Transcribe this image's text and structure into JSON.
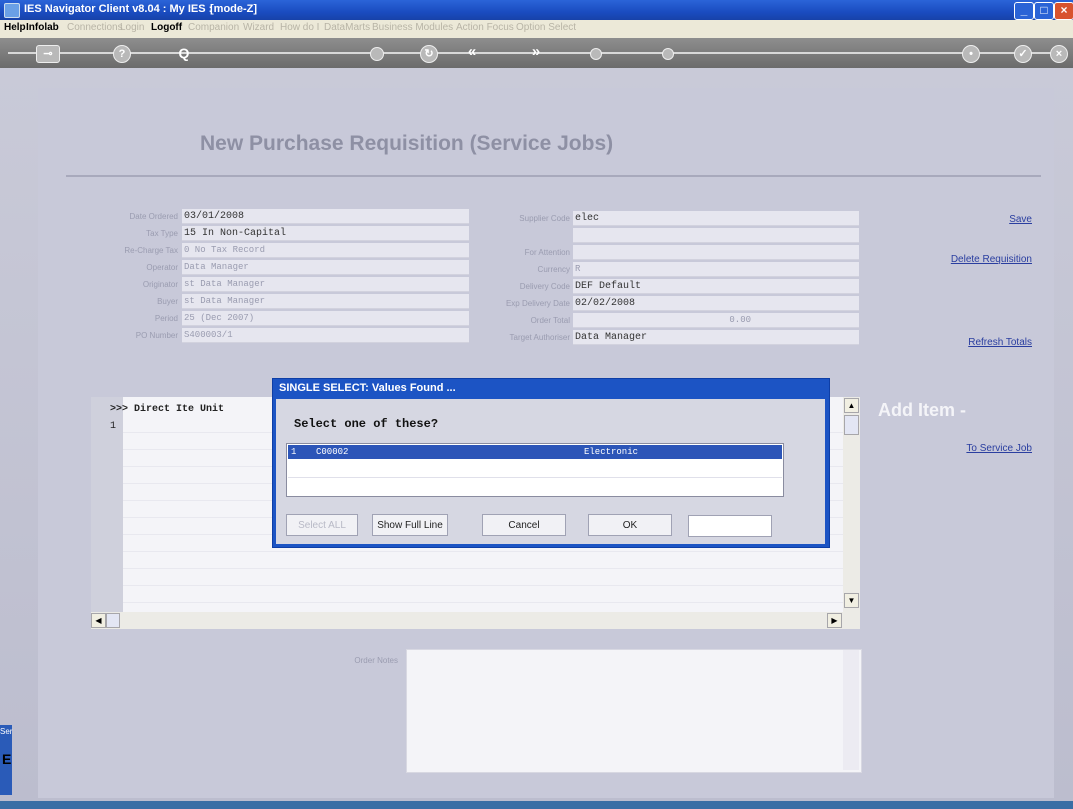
{
  "window": {
    "title": "IES Navigator Client v8.04 : My IES :",
    "mode": "[mode-Z]"
  },
  "menu": [
    {
      "label": "Help",
      "active": true
    },
    {
      "label": "Infolab",
      "active": true
    },
    {
      "label": "Connections",
      "active": false
    },
    {
      "label": "Login",
      "active": false
    },
    {
      "label": "Logoff",
      "active": true
    },
    {
      "label": "Companion",
      "active": false
    },
    {
      "label": "Wizard",
      "active": false
    },
    {
      "label": "How do I",
      "active": false
    },
    {
      "label": "DataMarts",
      "active": false
    },
    {
      "label": "Business Modules",
      "active": false
    },
    {
      "label": "Action Focus",
      "active": false
    },
    {
      "label": "Option Select",
      "active": false
    }
  ],
  "toolbar": {
    "help_icon": "?",
    "search_icon": "Q",
    "back_icon": "«",
    "forward_icon": "»",
    "confirm_icon": "✓",
    "close_icon": "×"
  },
  "page": {
    "title": "New Purchase Requisition (Service Jobs)"
  },
  "left_fields": [
    {
      "label": "Date Ordered",
      "value": "03/01/2008",
      "faint": false
    },
    {
      "label": "Tax Type",
      "value": "15 In Non-Capital",
      "faint": false
    },
    {
      "label": "Re-Charge Tax",
      "value": "0 No Tax Record",
      "faint": true
    },
    {
      "label": "Operator",
      "value": "Data Manager",
      "faint": true
    },
    {
      "label": "Originator",
      "value": "st Data Manager",
      "faint": true
    },
    {
      "label": "Buyer",
      "value": "st Data Manager",
      "faint": true
    },
    {
      "label": "Period",
      "value": "25  (Dec 2007)",
      "faint": true
    },
    {
      "label": "PO Number",
      "value": "S400003/1",
      "faint": true
    }
  ],
  "right_fields": [
    {
      "label": "Supplier Code",
      "value": "elec",
      "faint": false
    },
    {
      "label": "",
      "value": "",
      "faint": false
    },
    {
      "label": "For Attention",
      "value": "",
      "faint": false
    },
    {
      "label": "Currency",
      "value": "R",
      "faint": true
    },
    {
      "label": "Delivery Code",
      "value": "DEF Default",
      "faint": false
    },
    {
      "label": "Exp Delivery Date",
      "value": "02/02/2008",
      "faint": false
    },
    {
      "label": "Order Total",
      "value": "0.00",
      "faint": true
    },
    {
      "label": "Target Authoriser",
      "value": "Data Manager",
      "faint": false
    }
  ],
  "actions": {
    "save": "Save",
    "delete": "Delete Requisition",
    "refresh": "Refresh Totals",
    "add_item": "Add Item -",
    "to_service_job": "To Service Job"
  },
  "grid": {
    "header": ">>> Direct Ite Unit",
    "row_number": "1"
  },
  "notes": {
    "label": "Order Notes"
  },
  "dialog": {
    "title": "SINGLE SELECT: Values Found ...",
    "prompt": "Select one of these?",
    "selected_row": {
      "index": "1",
      "code": "C00002",
      "name": "Electronic"
    },
    "buttons": {
      "select_all": "Select ALL",
      "show_full_line": "Show Full Line",
      "cancel": "Cancel",
      "ok": "OK"
    }
  },
  "side_tab": {
    "top": "Ser",
    "letter": "E"
  }
}
